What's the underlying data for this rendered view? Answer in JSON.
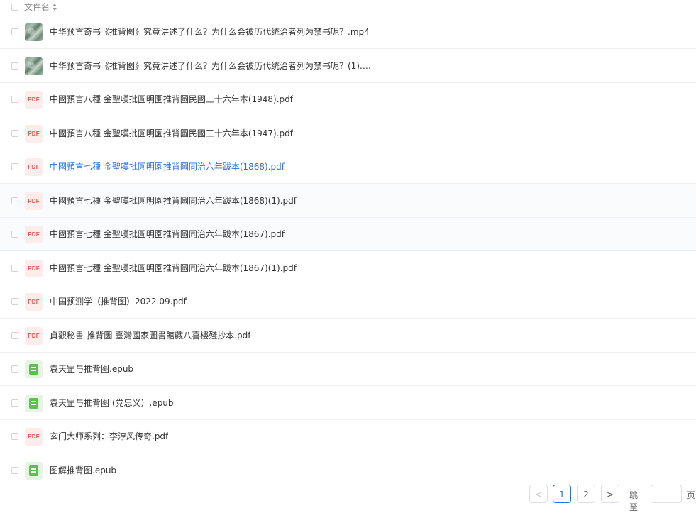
{
  "header": {
    "column_label": "文件名",
    "sort_icon": "sort-icon"
  },
  "files": [
    {
      "name": "中华预言奇书《推背图》究竟讲述了什么？为什么会被历代统治者列为禁书呢？.mp4",
      "type": "video",
      "icon": "video-thumbnail-icon"
    },
    {
      "name": "中华预言奇书《推背图》究竟讲述了什么？为什么会被历代统治者列为禁书呢？(1).m...",
      "type": "video",
      "icon": "video-thumbnail-icon"
    },
    {
      "name": "中國預言八種 金聖嘆批圓明園推背圖民國三十六年本(1948).pdf",
      "type": "pdf",
      "icon": "pdf-icon",
      "badge": "PDF"
    },
    {
      "name": "中國預言八種 金聖嘆批圓明園推背圖民國三十六年本(1947).pdf",
      "type": "pdf",
      "icon": "pdf-icon",
      "badge": "PDF"
    },
    {
      "name": "中國預言七種 金聖嘆批圓明園推背圖同治六年跋本(1868).pdf",
      "type": "pdf",
      "icon": "pdf-icon",
      "badge": "PDF",
      "active": true
    },
    {
      "name": "中國預言七種 金聖嘆批圓明園推背圖同治六年跋本(1868)(1).pdf",
      "type": "pdf",
      "icon": "pdf-icon",
      "badge": "PDF",
      "highlight": true
    },
    {
      "name": "中國預言七種 金聖嘆批圓明園推背圖同治六年跋本(1867).pdf",
      "type": "pdf",
      "icon": "pdf-icon",
      "badge": "PDF",
      "highlight": true
    },
    {
      "name": "中國預言七種 金聖嘆批圓明園推背圖同治六年跋本(1867)(1).pdf",
      "type": "pdf",
      "icon": "pdf-icon",
      "badge": "PDF"
    },
    {
      "name": "中国预测学（推背图）2022.09.pdf",
      "type": "pdf",
      "icon": "pdf-icon",
      "badge": "PDF"
    },
    {
      "name": "貞觀秘書-推背圖 臺灣國家圖書館藏八喜樓殘抄本.pdf",
      "type": "pdf",
      "icon": "pdf-icon",
      "badge": "PDF"
    },
    {
      "name": "袁天罡与推背图.epub",
      "type": "epub",
      "icon": "epub-book-icon"
    },
    {
      "name": "袁天罡与推背图 (党忠义）.epub",
      "type": "epub",
      "icon": "epub-book-icon"
    },
    {
      "name": "玄门大师系列：李淳风传奇.pdf",
      "type": "pdf",
      "icon": "pdf-icon",
      "badge": "PDF"
    },
    {
      "name": "图解推背图.epub",
      "type": "epub",
      "icon": "epub-book-icon"
    }
  ],
  "pagination": {
    "prev_label": "<",
    "pages": [
      "1",
      "2"
    ],
    "current_page": "1",
    "next_label": ">",
    "jump_label": "跳至",
    "jump_value": "",
    "page_unit": "页"
  },
  "colors": {
    "active_link": "#2a6fdb",
    "pdf_red": "#e8534f",
    "epub_green": "#5fbf55"
  }
}
